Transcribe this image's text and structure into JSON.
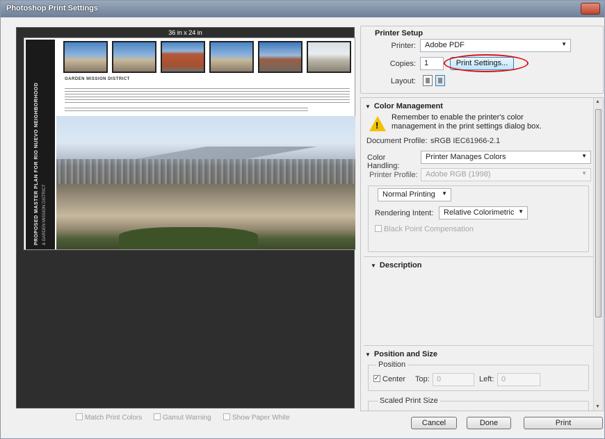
{
  "window": {
    "title": "Photoshop Print Settings"
  },
  "preview": {
    "size_label": "36 in x 24 in",
    "page_heading": "GARDEN MISSION DISTRICT",
    "vertical_title": "PROPOSED MASTER PLAN FOR RIO NUEVO NEIGHBORHOOD",
    "vertical_subtitle": "& GARDEN MISSION DISTRICT"
  },
  "preview_options": [
    {
      "label": "Match Print Colors",
      "checked": false
    },
    {
      "label": "Gamut Warning",
      "checked": false
    },
    {
      "label": "Show Paper White",
      "checked": false
    }
  ],
  "printer_setup": {
    "title": "Printer Setup",
    "printer_label": "Printer:",
    "printer_value": "Adobe PDF",
    "copies_label": "Copies:",
    "copies_value": "1",
    "print_settings_button": "Print Settings...",
    "layout_label": "Layout:"
  },
  "color_management": {
    "title": "Color Management",
    "warning": "Remember to enable the printer's color management in the print settings dialog box.",
    "document_profile_label": "Document Profile:",
    "document_profile_value": "sRGB IEC61966-2.1",
    "color_handling_label": "Color Handling:",
    "color_handling_value": "Printer Manages Colors",
    "printer_profile_label": "Printer Profile:",
    "printer_profile_value": "Adobe RGB (1998)",
    "printing_mode_value": "Normal Printing",
    "rendering_intent_label": "Rendering Intent:",
    "rendering_intent_value": "Relative Colorimetric",
    "black_point_label": "Black Point Compensation"
  },
  "description": {
    "title": "Description"
  },
  "position_size": {
    "title": "Position and Size",
    "position_group": "Position",
    "center_label": "Center",
    "center_checked": true,
    "top_label": "Top:",
    "top_value": "0",
    "left_label": "Left:",
    "left_value": "0",
    "scaled_group": "Scaled Print Size"
  },
  "buttons": {
    "cancel": "Cancel",
    "done": "Done",
    "print": "Print"
  },
  "colors": {
    "highlight_ring": "#d8141a",
    "warning": "#f2c200"
  }
}
